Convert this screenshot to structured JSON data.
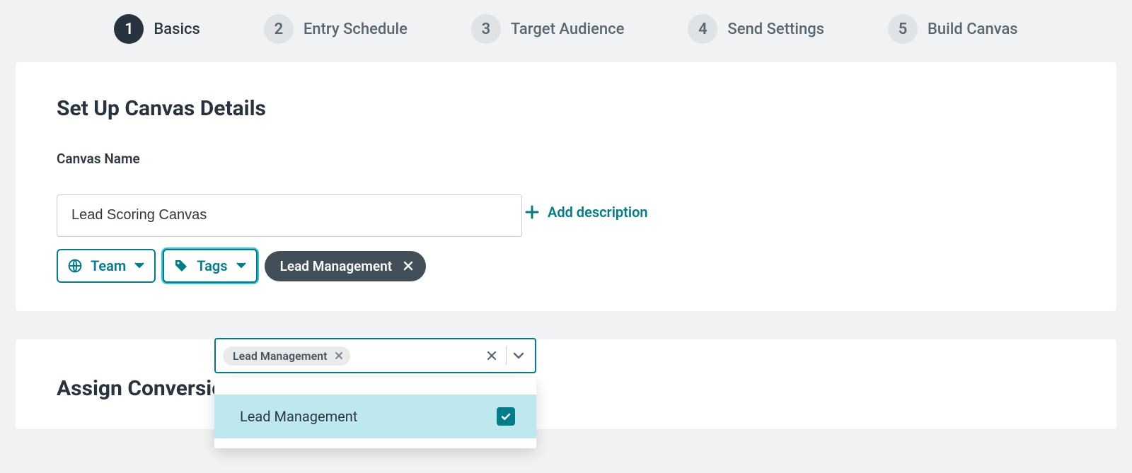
{
  "stepper": {
    "steps": [
      {
        "num": "1",
        "label": "Basics",
        "active": true
      },
      {
        "num": "2",
        "label": "Entry Schedule",
        "active": false
      },
      {
        "num": "3",
        "label": "Target Audience",
        "active": false
      },
      {
        "num": "4",
        "label": "Send Settings",
        "active": false
      },
      {
        "num": "5",
        "label": "Build Canvas",
        "active": false
      }
    ]
  },
  "card1": {
    "title": "Set Up Canvas Details",
    "canvas_name_label": "Canvas Name",
    "canvas_name_value": "Lead Scoring Canvas",
    "add_description": "Add description",
    "team_pill": "Team",
    "tags_pill": "Tags",
    "tag_chip": "Lead Management"
  },
  "tags_combo": {
    "token": "Lead Management",
    "option": "Lead Management",
    "option_selected": true
  },
  "card2": {
    "title": "Assign Conversion Events"
  },
  "colors": {
    "accent": "#007d8a",
    "dark": "#27333f",
    "chip": "#434f58",
    "highlight": "#bce8ee"
  }
}
